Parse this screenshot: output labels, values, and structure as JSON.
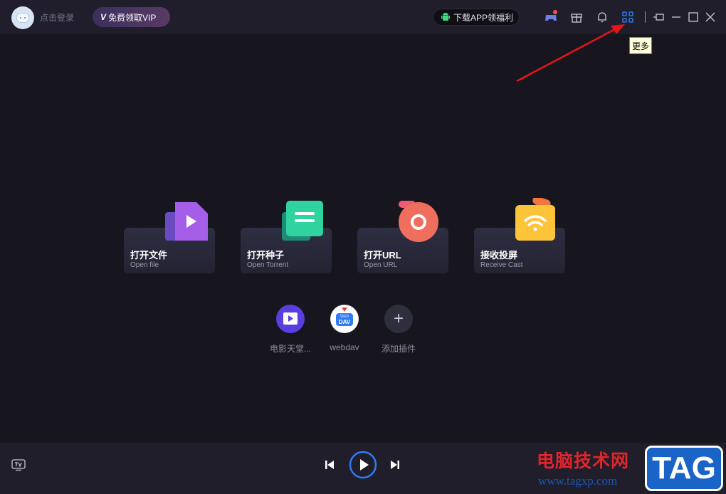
{
  "titlebar": {
    "login_label": "点击登录",
    "vip_badge": "V",
    "vip_label": "免费领取VIP",
    "app_download_label": "下载APP领福利",
    "icons": [
      "game-icon",
      "gift-icon",
      "bell-icon",
      "more-grid-icon",
      "pin-icon",
      "minimize-icon",
      "maximize-icon",
      "close-icon"
    ],
    "tooltip": "更多",
    "accent": "#2f7bf5"
  },
  "cards": [
    {
      "cn": "打开文件",
      "en": "Open file"
    },
    {
      "cn": "打开种子",
      "en": "Open Torrent"
    },
    {
      "cn": "打开URL",
      "en": "Open URL"
    },
    {
      "cn": "接收投屏",
      "en": "Receive Cast"
    }
  ],
  "plugins": [
    {
      "label": "电影天堂..."
    },
    {
      "label": "webdav",
      "badge_small": "Web",
      "badge_big": "DAV"
    },
    {
      "label": "添加插件",
      "symbol": "+"
    }
  ],
  "watermark": {
    "text": "电脑技术网",
    "url": "www.tagxp.com",
    "tag": "TAG"
  },
  "colors": {
    "background": "#17161f",
    "bar": "#1f1e2a",
    "play_ring": "#2f7bf5",
    "annotation_arrow": "#e5141b"
  }
}
